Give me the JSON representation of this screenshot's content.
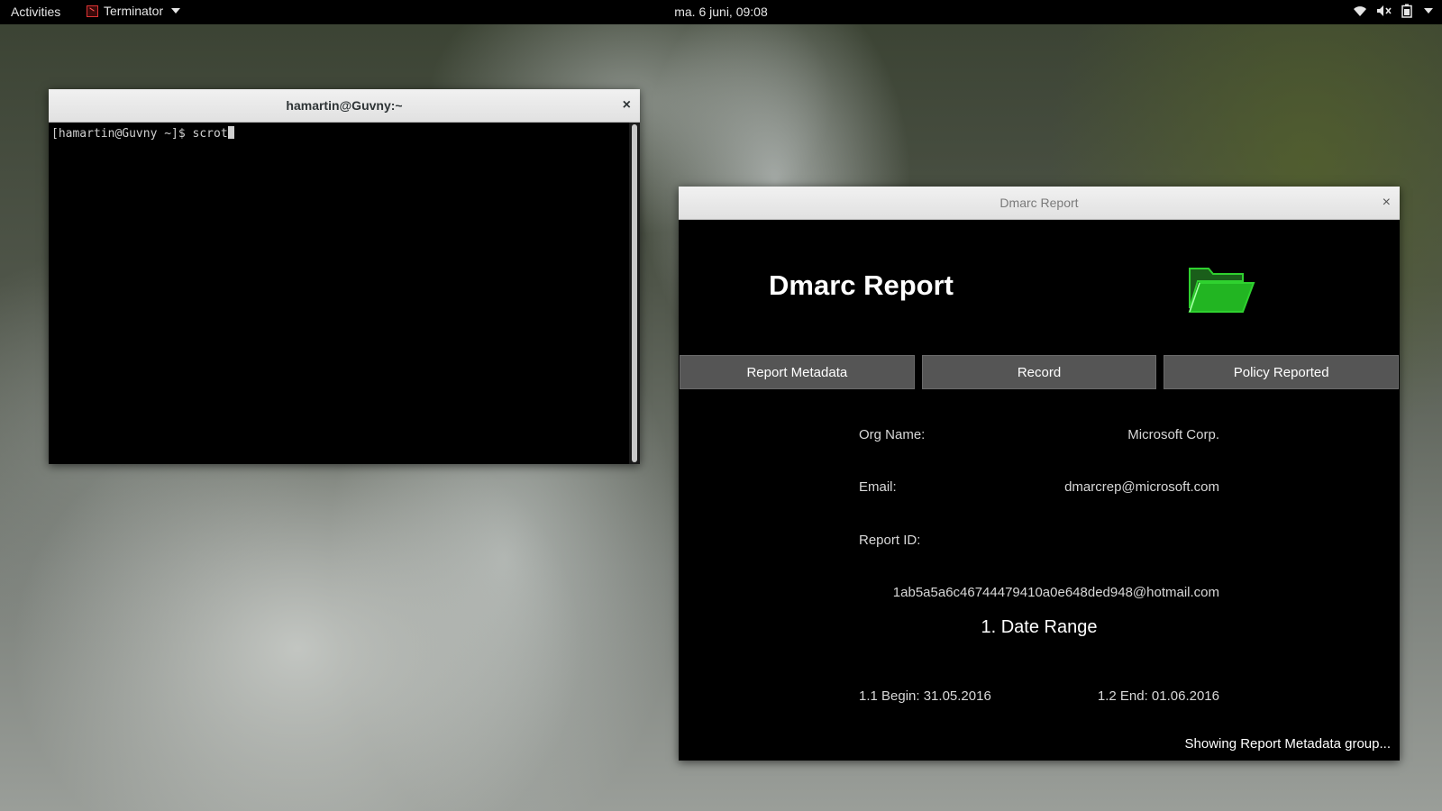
{
  "topbar": {
    "activities": "Activities",
    "app_name": "Terminator",
    "clock": "ma.  6 juni, 09:08",
    "status_icons": [
      "wifi-icon",
      "volume-icon",
      "battery-icon",
      "chevron-down-icon"
    ]
  },
  "terminal": {
    "title": "hamartin@Guvny:~",
    "close_label": "×",
    "prompt": "[hamartin@Guvny ~]$ scrot"
  },
  "dmarc": {
    "window_title": "Dmarc Report",
    "close_label": "×",
    "heading": "Dmarc Report",
    "folder_icon": "folder-open-icon",
    "accent_color": "#22b522",
    "tabs": [
      {
        "label": "Report Metadata"
      },
      {
        "label": "Record"
      },
      {
        "label": "Policy Reported"
      }
    ],
    "org_name_label": "Org Name:",
    "org_name_value": "Microsoft Corp.",
    "email_label": "Email:",
    "email_value": "dmarcrep@microsoft.com",
    "report_id_label": "Report ID:",
    "report_id_value": "1ab5a5a6c46744479410a0e648ded948@hotmail.com",
    "section_title": "1. Date Range",
    "begin_label": "1.1 Begin: 31.05.2016",
    "end_label": "1.2 End: 01.06.2016",
    "status": "Showing Report Metadata group..."
  }
}
